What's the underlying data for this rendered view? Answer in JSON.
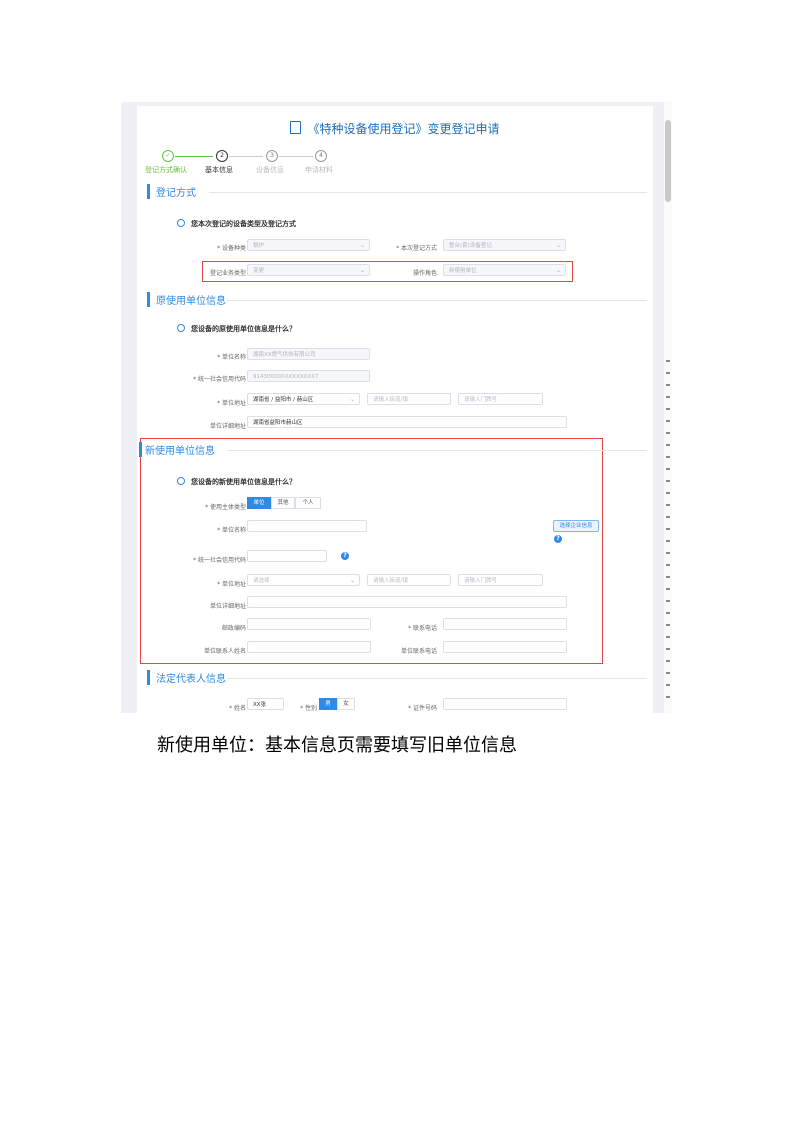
{
  "page": {
    "title": "《特种设备使用登记》变更登记申请",
    "caption": "新使用单位：基本信息页需要填写旧单位信息"
  },
  "steps": [
    {
      "num": "✓",
      "label": "登记方式确认"
    },
    {
      "num": "2",
      "label": "基本信息"
    },
    {
      "num": "3",
      "label": "设备信息"
    },
    {
      "num": "4",
      "label": "申请材料"
    }
  ],
  "section1": {
    "title": "登记方式",
    "question": "您本次登记的设备类型及登记方式",
    "equip_type_label": "* 设备种类",
    "equip_type_value": "锅炉",
    "method_label": "* 本次登记方式",
    "method_value": "整台(套)设备登记",
    "biz_type_label": "登记业务类型",
    "biz_type_value": "变更",
    "role_label": "操作角色",
    "role_value": "新使用单位"
  },
  "section2": {
    "title": "原使用单位信息",
    "question": "您设备的原使用单位信息是什么？",
    "name_label": "* 单位名称",
    "name_value": "湖南XX燃气供热有限公司",
    "credit_label": "* 统一社会信用代码",
    "credit_value": "91430000XXXXXXXXX7",
    "address_label": "* 单位地址",
    "address_value": "湖南省 / 益阳市 / 赫山区",
    "street_placeholder": "请输入街道/镇",
    "door_placeholder": "请输入门牌号",
    "detail_label": "单位详细地址",
    "detail_value": "湖南省益阳市赫山区"
  },
  "section3": {
    "title": "新使用单位信息",
    "question": "您设备的新使用单位信息是什么？",
    "subject_label": "* 使用主体类型",
    "subject_options": [
      "单位",
      "其他",
      "个人"
    ],
    "name_label": "* 单位名称",
    "select_button": "选择企业信息",
    "credit_label": "* 统一社会信用代码",
    "address_label": "* 单位地址",
    "address_placeholder": "请选择",
    "street_placeholder": "请输入街道/镇",
    "door_placeholder": "请输入门牌号",
    "detail_label": "单位详细地址",
    "postcode_label": "邮政编码",
    "phone_label": "* 联系电话",
    "contact_label": "单位联系人姓名",
    "mobile_label": "单位联系电话"
  },
  "section4": {
    "title": "法定代表人信息",
    "name_label": "* 姓名",
    "name_value": "XX张",
    "gender_label": "* 性别",
    "gender_options": [
      "男",
      "女"
    ],
    "id_label": "* 证件号码"
  },
  "colors": {
    "accent": "#2f8ae4",
    "success": "#67c23a",
    "highlight": "#e64545"
  }
}
